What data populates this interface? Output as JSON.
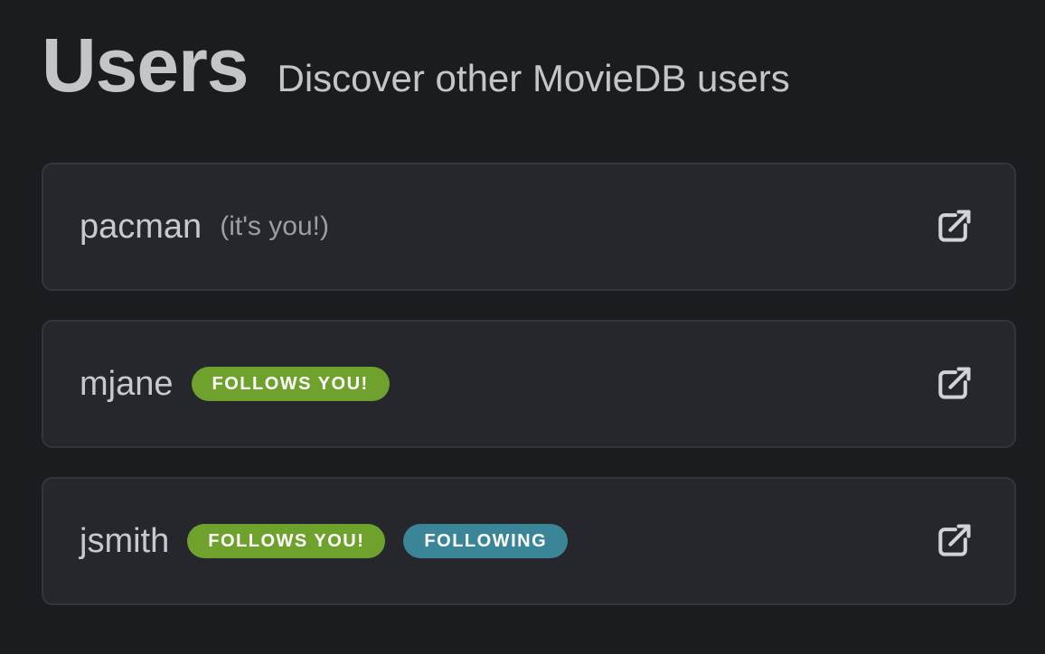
{
  "header": {
    "title": "Users",
    "subtitle": "Discover other MovieDB users"
  },
  "users": [
    {
      "username": "pacman",
      "note": "(it's you!)",
      "badges": [],
      "action_icon": "external-link-icon"
    },
    {
      "username": "mjane",
      "note": "",
      "badges": [
        {
          "label": "FOLLOWS YOU!",
          "kind": "follows",
          "color": "#6fa22d"
        }
      ],
      "action_icon": "external-link-icon"
    },
    {
      "username": "jsmith",
      "note": "",
      "badges": [
        {
          "label": "FOLLOWS YOU!",
          "kind": "follows",
          "color": "#6fa22d"
        },
        {
          "label": "FOLLOWING",
          "kind": "following",
          "color": "#3a8597"
        }
      ],
      "action_icon": "external-link-icon"
    }
  ],
  "colors": {
    "background": "#1b1c1f",
    "card": "#26272c",
    "text": "#c4c5c8"
  }
}
